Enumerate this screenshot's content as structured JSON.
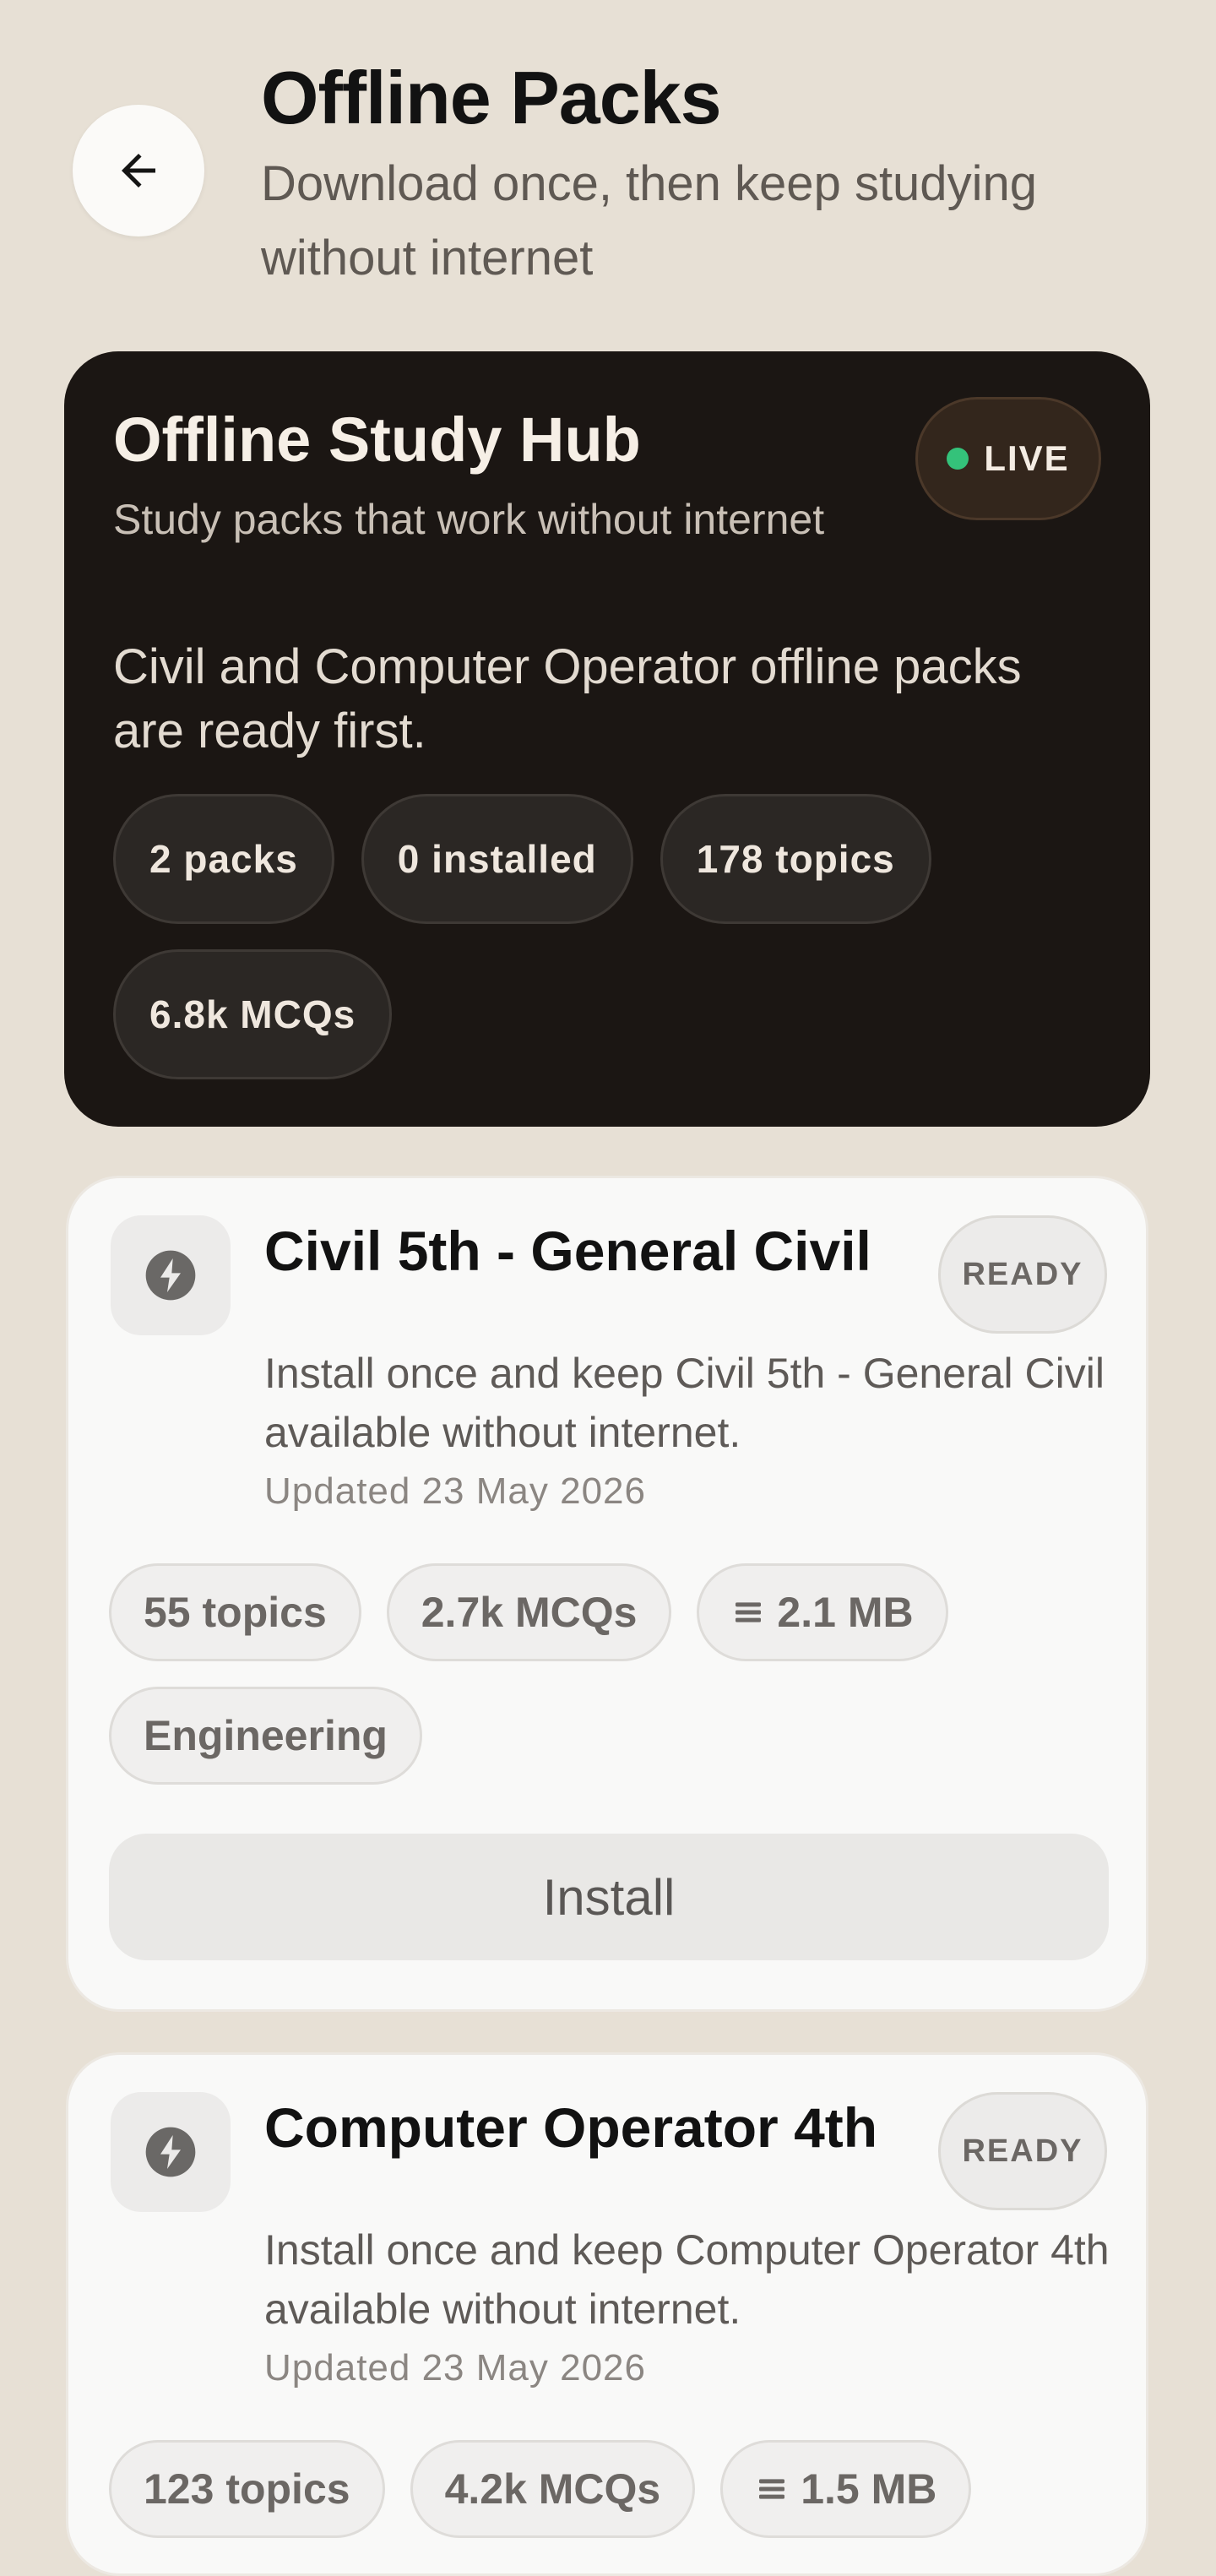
{
  "header": {
    "back_icon": "arrow-left-icon",
    "title": "Offline Packs",
    "subtitle": "Download once, then keep studying without internet"
  },
  "hub": {
    "title": "Offline Study Hub",
    "subtitle": "Study packs that work without internet",
    "description": "Civil and Computer Operator offline packs are ready first.",
    "live_label": "LIVE",
    "live_color": "#34c27a",
    "chips": [
      "2 packs",
      "0 installed",
      "178 topics",
      "6.8k MCQs"
    ]
  },
  "packs": [
    {
      "icon": "bolt-icon",
      "title": "Civil 5th - General Civil",
      "status": "READY",
      "description": "Install once and keep Civil 5th - General Civil available without internet.",
      "updated": "Updated 23 May 2026",
      "topics": "55 topics",
      "mcqs": "2.7k MCQs",
      "size": "2.1 MB",
      "category": "Engineering",
      "install_label": "Install"
    },
    {
      "icon": "bolt-icon",
      "title": "Computer Operator 4th",
      "status": "READY",
      "description": "Install once and keep Computer Operator 4th available without internet.",
      "updated": "Updated 23 May 2026",
      "topics": "123 topics",
      "mcqs": "4.2k MCQs",
      "size": "1.5 MB",
      "category": "",
      "install_label": ""
    }
  ]
}
